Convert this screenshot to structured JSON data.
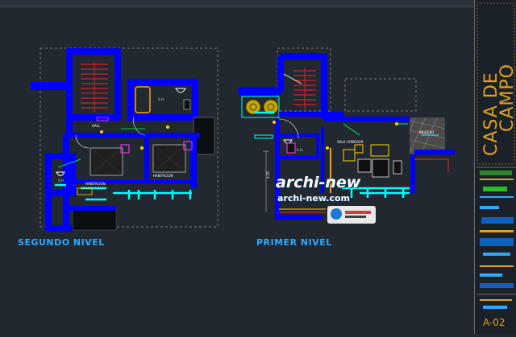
{
  "drawing": {
    "labels": {
      "second_floor": "SEGUNDO NIVEL",
      "first_floor": "PRIMER NIVEL"
    },
    "rooms_second": {
      "hall": "HALL",
      "sh_top": "S.H.",
      "sh_left": "S.H.",
      "bedroom_1": "HABITACION",
      "bedroom_2": "HABITACION"
    },
    "rooms_first": {
      "sh": "S.H.",
      "sala": "SALA COMEDOR",
      "ingreso": "INGRESO",
      "dim": "4.25"
    },
    "title_block": {
      "title_line1": "CASA DE",
      "title_line2": "CAMPO",
      "sheet": "A-02"
    },
    "watermark": {
      "brand": "archi-new",
      "site": "archi-new.com"
    }
  },
  "colors": {
    "background": "#212830",
    "wall": "#0000ff",
    "stair": "#ff2020",
    "fixture": "#e040e0",
    "cyan": "#00ffff",
    "label": "#2fa8ff",
    "title": "#e0a020",
    "gold": "#ffd000",
    "green": "#28c020",
    "dark_green": "#2a8a2a"
  },
  "icons": [
    "door-swing-icon",
    "toilet-icon",
    "bed-icon",
    "stair-icon",
    "tree-icon"
  ]
}
